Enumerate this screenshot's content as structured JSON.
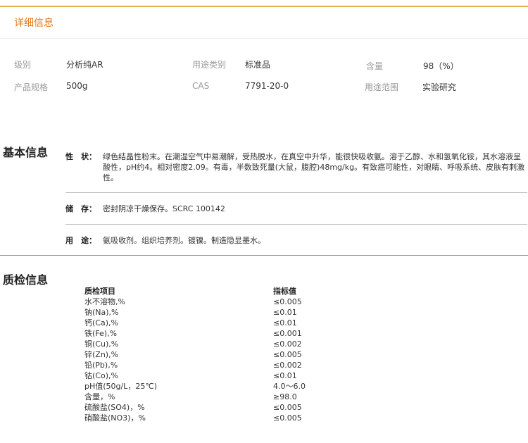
{
  "detail_tab": {
    "label": "详细信息"
  },
  "attributes": {
    "row1": [
      {
        "label": "级别",
        "value": "分析纯AR"
      },
      {
        "label": "用途类别",
        "value": "标准品"
      },
      {
        "label": "含量",
        "value": "98（%）"
      }
    ],
    "row2": [
      {
        "label": "产品规格",
        "value": "500g"
      },
      {
        "label": "CAS",
        "value": "7791-20-0"
      },
      {
        "label": "用途范围",
        "value": "实验研究"
      }
    ]
  },
  "basic_info": {
    "heading": "基本信息",
    "rows": [
      {
        "label": "性　状：",
        "text": "绿色结晶性粉末。在潮湿空气中易潮解，受热脱水，在真空中升华，能很快吸收氨。溶于乙醇、水和氢氧化铵，其水溶液呈酸性，pH约4。相对密度2.09。有毒，半数致死量(大鼠，腹腔)48mg/kg。有致癌可能性，对眼睛、呼吸系统、皮肤有刺激性。"
      },
      {
        "label": "储　存：",
        "text": "密封阴凉干燥保存。SCRC 100142"
      },
      {
        "label": "用　途：",
        "text": "氨吸收剂。组织培养剂。镀镍。制造隐显墨水。"
      }
    ]
  },
  "quality_info": {
    "heading": "质检信息",
    "header": {
      "item": "质检项目",
      "value": "指标值"
    },
    "rows": [
      {
        "item": "水不溶物,%",
        "value": "≤0.005"
      },
      {
        "item": "钠(Na),%",
        "value": "≤0.01"
      },
      {
        "item": "钙(Ca),%",
        "value": "≤0.01"
      },
      {
        "item": "铁(Fe),%",
        "value": "≤0.001"
      },
      {
        "item": "铜(Cu),%",
        "value": "≤0.002"
      },
      {
        "item": "锌(Zn),%",
        "value": "≤0.005"
      },
      {
        "item": "铅(Pb),%",
        "value": "≤0.002"
      },
      {
        "item": "钴(Co),%",
        "value": "≤0.01"
      },
      {
        "item": "pH值(50g/L，25℃)",
        "value": "4.0～6.0"
      },
      {
        "item": "含量，%",
        "value": "≥98.0"
      },
      {
        "item": "硫酸盐(SO4)，%",
        "value": "≤0.005"
      },
      {
        "item": "硝酸盐(NO3)，%",
        "value": "≤0.005"
      }
    ]
  }
}
